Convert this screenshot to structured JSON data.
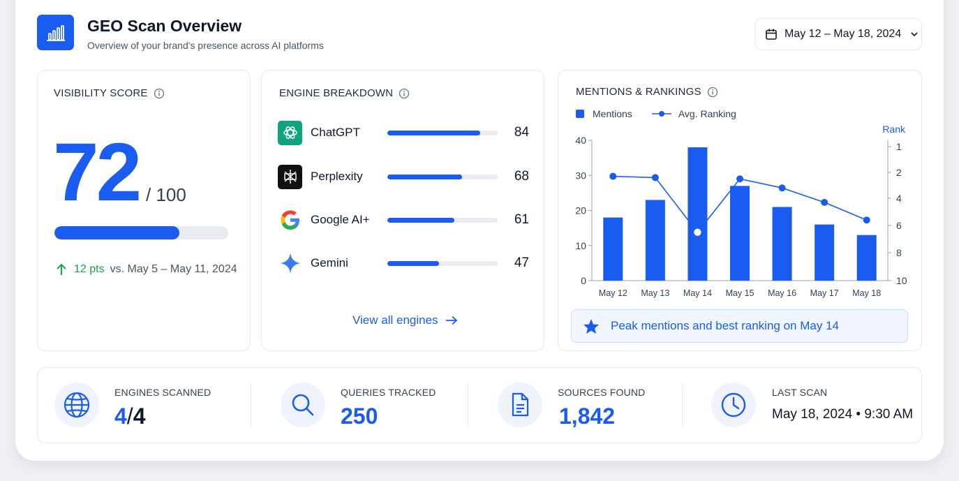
{
  "header": {
    "title": "GEO Scan Overview",
    "subtitle": "Overview of your brand's presence across AI platforms",
    "date_range": "May 12 – May 18, 2024"
  },
  "visibility": {
    "title": "VISIBILITY SCORE",
    "score": "72",
    "max": "/ 100",
    "score_fraction": 0.72,
    "delta": "12 pts",
    "delta_compare": "vs. May 5 – May 11, 2024"
  },
  "engines": {
    "title": "ENGINE BREAKDOWN",
    "items": [
      {
        "name": "ChatGPT",
        "value": "84",
        "icon": "chatgpt-icon"
      },
      {
        "name": "Perplexity",
        "value": "68",
        "icon": "perplexity-icon"
      },
      {
        "name": "Google AI+",
        "value": "61",
        "icon": "google-icon"
      },
      {
        "name": "Gemini",
        "value": "47",
        "icon": "gemini-icon"
      }
    ],
    "view_all": "View all engines"
  },
  "mentions": {
    "title": "MENTIONS & RANKINGS",
    "legend_mentions": "Mentions",
    "legend_ranking": "Avg. Ranking",
    "rank_label": "Rank",
    "peak_text": "Peak mentions and best ranking on May 14"
  },
  "chart_data": {
    "type": "bar",
    "categories": [
      "May 12",
      "May 13",
      "May 14",
      "May 15",
      "May 16",
      "May 17",
      "May 18"
    ],
    "series": [
      {
        "name": "Mentions",
        "type": "bar",
        "axis": "left",
        "values": [
          18,
          23,
          38,
          27,
          21,
          16,
          13
        ]
      },
      {
        "name": "Avg. Ranking",
        "type": "line",
        "axis": "right",
        "values": [
          2.3,
          2.4,
          6.5,
          2.5,
          3.2,
          4.3,
          5.6
        ]
      }
    ],
    "ylim": [
      0,
      40
    ],
    "yticks": [
      "0",
      "10",
      "20",
      "30",
      "40"
    ],
    "y2lim": [
      1,
      10
    ],
    "y2ticks": [
      "1",
      "2",
      "4",
      "6",
      "8",
      "10"
    ],
    "y2_inverted": true,
    "y2label": "Rank",
    "colors": {
      "bars": "#1a5cf0",
      "line": "#1a5cf0"
    }
  },
  "stats": {
    "engines_label": "ENGINES SCANNED",
    "engines_value": "4",
    "engines_total": "4",
    "queries_label": "QUERIES TRACKED",
    "queries_value": "250",
    "sources_label": "SOURCES FOUND",
    "sources_value": "1,842",
    "last_scan_label": "LAST SCAN",
    "last_scan_date": "May 18, 2024",
    "last_scan_time": "9:30 AM"
  },
  "colors": {
    "accent": "#1a5cf0",
    "positive": "#16a34a"
  }
}
